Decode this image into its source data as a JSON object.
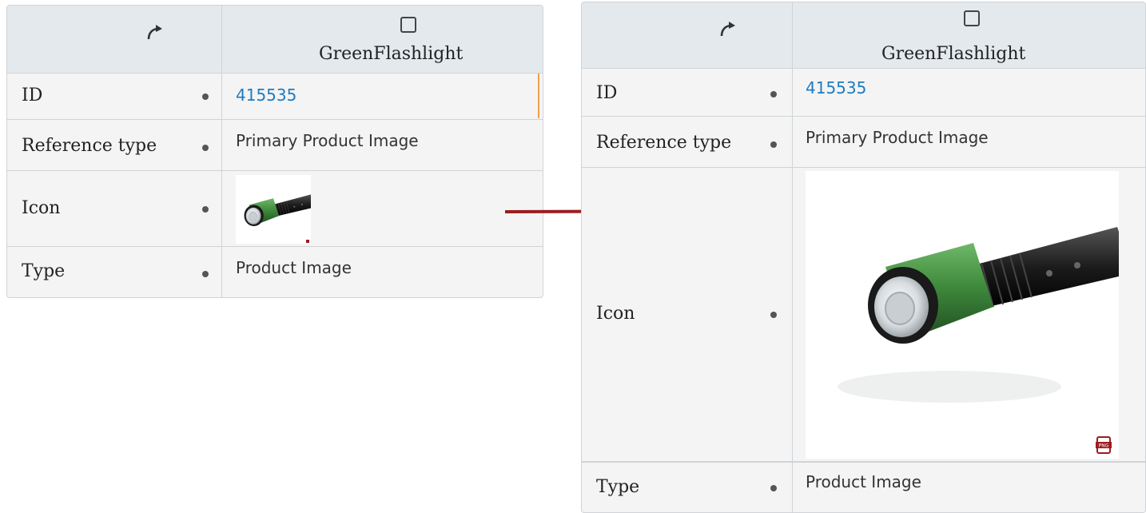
{
  "colors": {
    "link": "#1f7bbf",
    "header": "#e4e9ed",
    "arrow": "#9b1c20",
    "body": "#f4f4f4"
  },
  "before": {
    "header": {
      "refresh_icon": "refresh-icon",
      "column_title": "GreenFlashlight"
    },
    "rows": [
      {
        "label": "ID",
        "value": "415535"
      },
      {
        "label": "Reference type",
        "value": "Primary Product Image"
      },
      {
        "label": "Icon",
        "image": "green-flashlight-thumbnail"
      },
      {
        "label": "Type",
        "value": "Product Image"
      }
    ]
  },
  "after": {
    "header": {
      "refresh_icon": "refresh-icon",
      "column_title": "GreenFlashlight"
    },
    "rows": [
      {
        "label": "ID",
        "value": "415535"
      },
      {
        "label": "Reference type",
        "value": "Primary Product Image"
      },
      {
        "label": "Icon",
        "image": "green-flashlight-large",
        "badge": "png-file-icon"
      },
      {
        "label": "Type",
        "value": "Product Image"
      }
    ]
  }
}
